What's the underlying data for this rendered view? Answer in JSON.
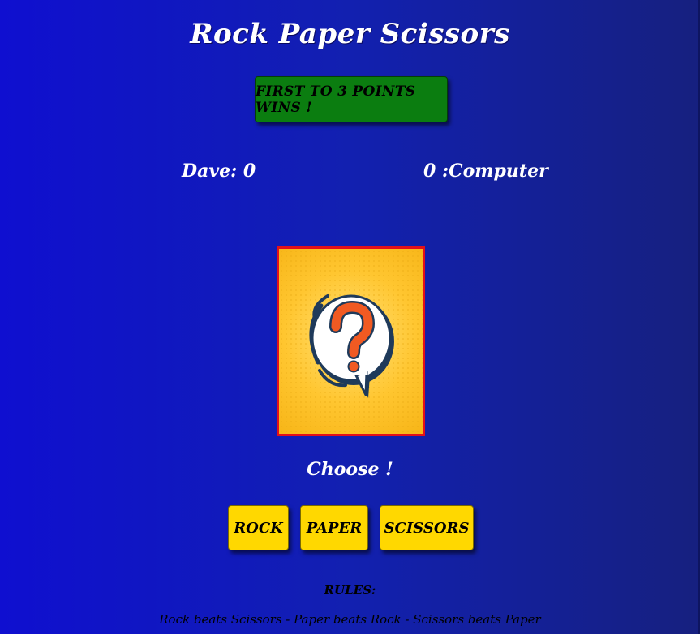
{
  "title": "Rock Paper Scissors",
  "banner": "FIRST TO 3 POINTS WINS !",
  "scores": {
    "player_label": "Dave: 0",
    "computer_label": "0 :Computer",
    "player_name": "Dave",
    "player_score": 0,
    "computer_name": "Computer",
    "computer_score": 0
  },
  "card": {
    "icon": "question-mark-speech-bubble-icon"
  },
  "choose_prompt": "Choose !",
  "buttons": {
    "rock": "ROCK",
    "paper": "PAPER",
    "scissors": "SCISSORS"
  },
  "rules": {
    "heading": "RULES:",
    "text": "Rock beats Scissors - Paper beats Rock - Scissors beats Paper"
  },
  "colors": {
    "background": "#1212c8",
    "banner": "#0b7d10",
    "button": "#ffd800",
    "card_border": "#e3101a",
    "card_fill": "#ffc630",
    "question_mark": "#f15a22"
  }
}
